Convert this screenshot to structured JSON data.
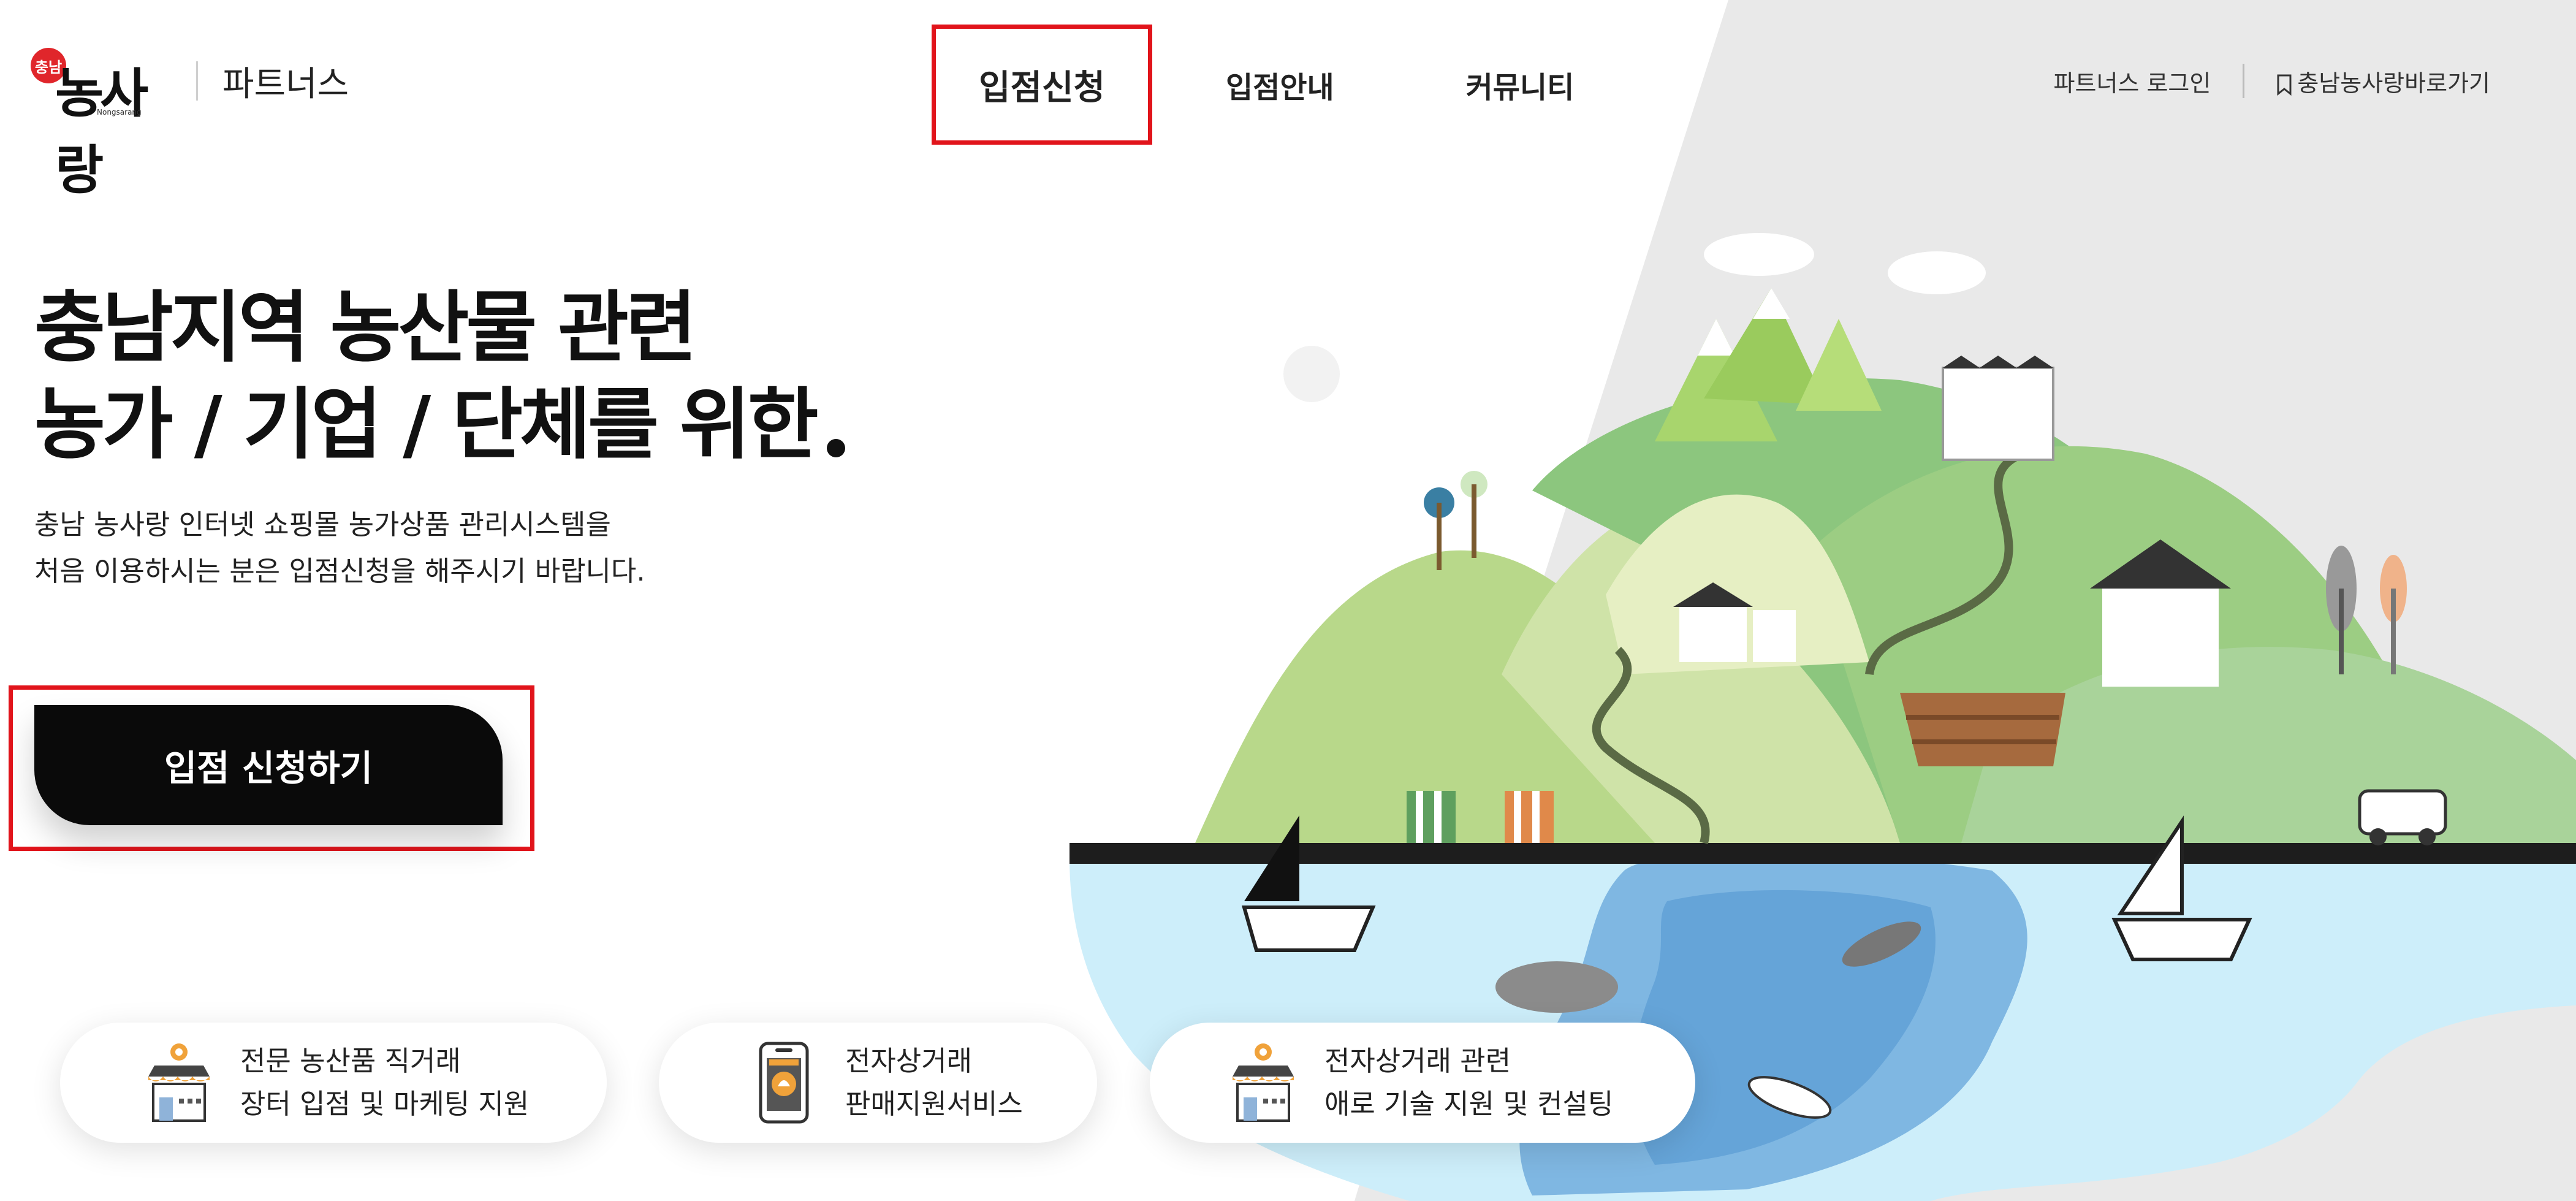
{
  "header": {
    "logo_badge": "충남",
    "logo_text": "농사랑",
    "logo_sub": "Nongsarang",
    "partners_label": "파트너스",
    "nav": [
      {
        "label": "입점신청"
      },
      {
        "label": "입점안내"
      },
      {
        "label": "커뮤니티"
      }
    ],
    "util": {
      "login": "파트너스 로그인",
      "shortcut": "충남농사랑바로가기"
    }
  },
  "hero": {
    "headline_line1": "충남지역 농산물 관련",
    "headline_line2": "농가 / 기업 / 단체를 위한",
    "sub_line1": "충남 농사랑 인터넷 쇼핑몰 농가상품 관리시스템을",
    "sub_line2": "처음 이용하시는 분은 입점신청을 해주시기 바랍니다.",
    "cta": "입점 신청하기"
  },
  "features": [
    {
      "icon": "market-stall-icon",
      "line1": "전문 농산품 직거래",
      "line2": "장터 입점 및 마케팅 지원"
    },
    {
      "icon": "mobile-shop-icon",
      "line1": "전자상거래",
      "line2": "판매지원서비스"
    },
    {
      "icon": "market-stall-icon",
      "line1": "전자상거래 관련",
      "line2": "애로 기술 지원 및 컨설팅"
    }
  ],
  "colors": {
    "highlight": "#e1141b",
    "cta_bg": "#0a0a0a",
    "logo_red": "#e0262b"
  }
}
